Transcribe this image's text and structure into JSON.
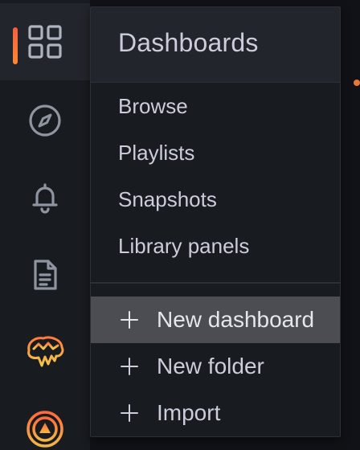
{
  "colors": {
    "rail_bg": "#181b1f",
    "rail_active_bg": "#22252b",
    "menu_bg": "#181b1f",
    "menu_header_bg": "#22252b",
    "hover_bg": "#4b4d53",
    "text": "#ccccdc",
    "icon": "#9fa7b3",
    "accent": "#f55f3e"
  },
  "rail": {
    "items": [
      {
        "name": "dashboards",
        "icon": "apps-grid-icon",
        "active": true
      },
      {
        "name": "explore",
        "icon": "compass-icon",
        "active": false
      },
      {
        "name": "alerting",
        "icon": "bell-icon",
        "active": false
      },
      {
        "name": "reports",
        "icon": "document-icon",
        "active": false
      },
      {
        "name": "ml",
        "icon": "brain-plugin-icon",
        "active": false
      },
      {
        "name": "oncall",
        "icon": "oncall-plugin-icon",
        "active": false
      }
    ]
  },
  "menu": {
    "title": "Dashboards",
    "links": [
      {
        "label": "Browse"
      },
      {
        "label": "Playlists"
      },
      {
        "label": "Snapshots"
      },
      {
        "label": "Library panels"
      }
    ],
    "actions": [
      {
        "label": "New dashboard",
        "icon": "plus-icon",
        "hovered": true
      },
      {
        "label": "New folder",
        "icon": "plus-icon",
        "hovered": false
      },
      {
        "label": "Import",
        "icon": "plus-icon",
        "hovered": false
      }
    ]
  }
}
